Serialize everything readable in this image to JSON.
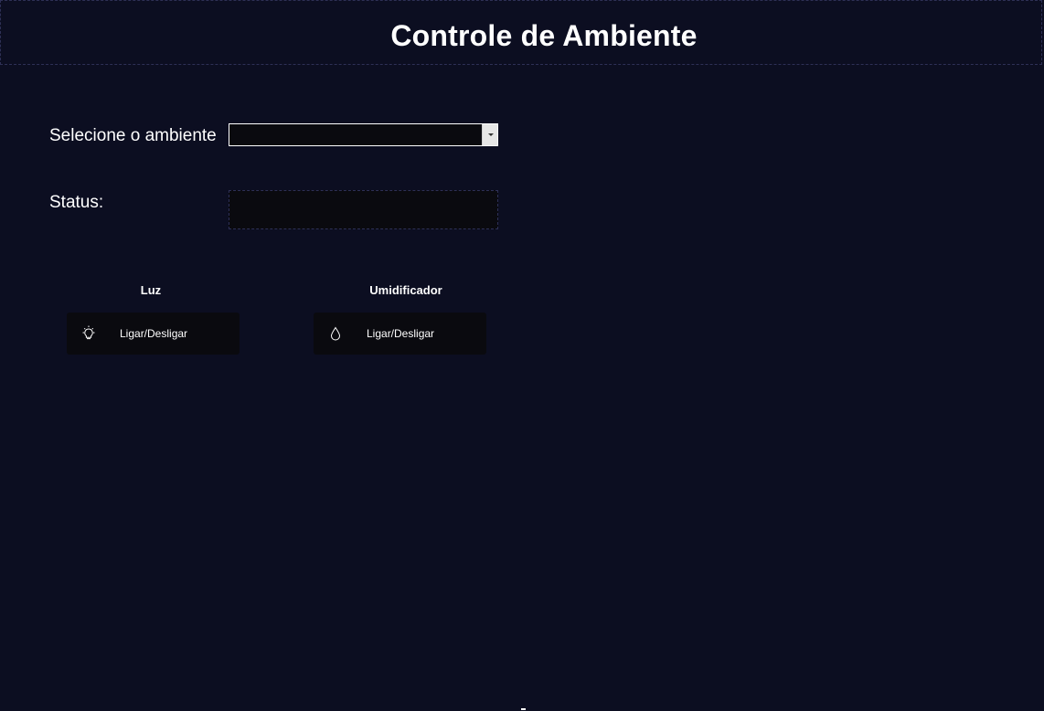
{
  "header": {
    "title": "Controle de Ambiente"
  },
  "environment": {
    "label": "Selecione o ambiente",
    "selected_value": ""
  },
  "status": {
    "label": "Status:",
    "value": ""
  },
  "controls": [
    {
      "label": "Luz",
      "button_label": "Ligar/Desligar",
      "icon": "lightbulb-icon"
    },
    {
      "label": "Umidificador",
      "button_label": "Ligar/Desligar",
      "icon": "water-drop-icon"
    }
  ],
  "colors": {
    "background": "#0c0e21",
    "panel": "#0a0a0f",
    "text": "#ffffff",
    "dashed_border": "#2e3056"
  }
}
